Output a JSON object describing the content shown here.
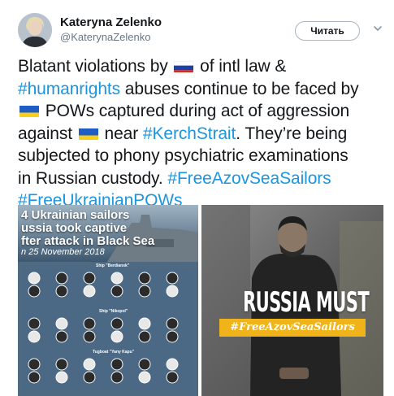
{
  "author": {
    "name": "Kateryna Zelenko",
    "handle": "@KaterynaZelenko"
  },
  "actions": {
    "follow_label": "Читать"
  },
  "tweet": {
    "lines": [
      [
        "Blatant violations by ",
        "flag:ru",
        " of intl law &"
      ],
      [
        "tag:#humanrights",
        " abuses continue to be faced by"
      ],
      [
        "flag:ua",
        " POWs captured during act of aggression"
      ],
      [
        "against ",
        "flag:ua",
        " near ",
        "tag:#KerchStrait",
        ". They’re being"
      ],
      [
        "subjected to phony psychiatric examinations"
      ],
      [
        "in Russian custody. ",
        "tag:#FreeAzovSeaSailors"
      ],
      [
        "tag:#FreeUkrainianPOWs"
      ]
    ]
  },
  "media": {
    "left_image": {
      "title_lines": [
        "4 Ukrainian sailors",
        "ussia took captive",
        "fter attack in Black Sea"
      ],
      "date": "n 25 November 2018",
      "ship_labels": [
        "Ship \"Berdiansk\"",
        "Ship \"Nikopol\"",
        "Tugboat \"Yany Kapu\""
      ]
    },
    "right_image": {
      "headline": "RUSSIA MUST",
      "hashtag": "#FreeAzovSeaSailors"
    }
  },
  "colors": {
    "link": "#1b95e0",
    "text": "#14171a",
    "secondary": "#657786",
    "banner": "#f0b41a"
  },
  "icons": {
    "caret": "chevron-down-icon",
    "flags": [
      "russia-flag",
      "ukraine-flag"
    ]
  }
}
